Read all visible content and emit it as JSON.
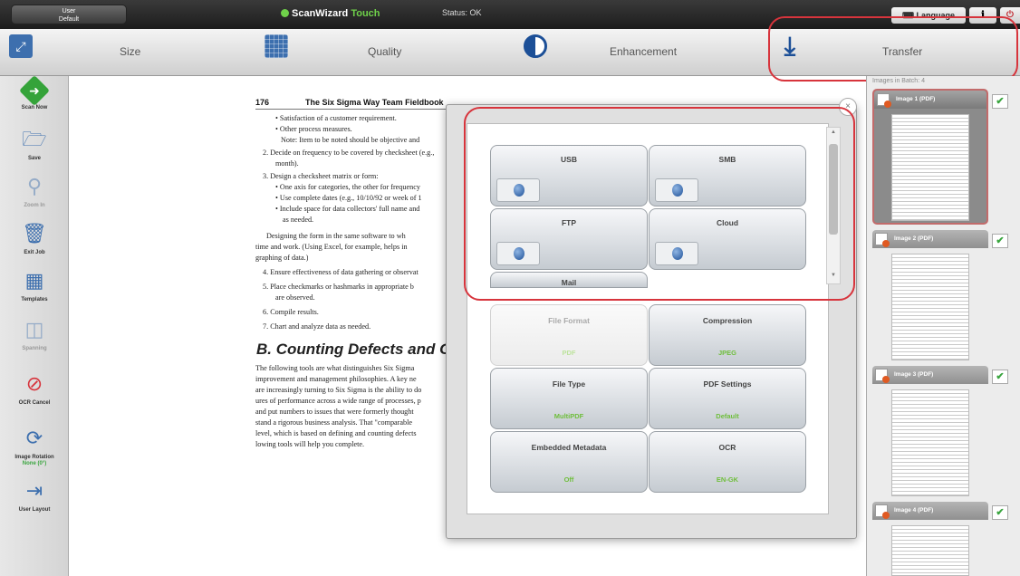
{
  "header": {
    "user_line1": "User",
    "user_line2": "Default",
    "app_name": "ScanWizard",
    "app_accent": "Touch",
    "status": "Status: OK",
    "language_label": "Language"
  },
  "toolbar": {
    "size_label": "Size",
    "quality_label": "Quality",
    "enhancement_label": "Enhancement",
    "transfer_label": "Transfer"
  },
  "sidebar": {
    "items": [
      {
        "label": "Scan Now",
        "icon": "scan-icon"
      },
      {
        "label": "Save",
        "icon": "folder-icon"
      },
      {
        "label": "Zoom In",
        "icon": "zoom-icon"
      },
      {
        "label": "Exit Job",
        "icon": "trash-icon"
      },
      {
        "label": "Templates",
        "icon": "templates-icon"
      },
      {
        "label": "Spanning",
        "icon": "spanning-icon"
      },
      {
        "label": "OCR Cancel",
        "icon": "ocr-cancel-icon"
      },
      {
        "label": "Image Rotation",
        "icon": "rotate-icon"
      },
      {
        "label": "User Layout",
        "icon": "exit-icon"
      }
    ],
    "rotation_value": "None (0°)"
  },
  "document": {
    "page_number": "176",
    "running_head": "The Six Sigma Way Team Fieldbook",
    "lines": [
      "• Satisfaction of a customer requirement.",
      "• Other process measures.",
      "Note: Item to be noted should be objective and",
      "2. Decide on frequency to be covered by checksheet (e.g.,",
      "month).",
      "3. Design a checksheet matrix or form:",
      "• One axis for categories, the other for frequency",
      "• Use complete dates (e.g., 10/10/92 or week of 1",
      "• Include space for data collectors' full name and",
      "as needed.",
      "Designing the form in the same software to wh",
      "time and work. (Using Excel, for example, helps in",
      "graphing of data.)",
      "4. Ensure effectiveness of data gathering or observat",
      "5. Place checkmarks or hashmarks in appropriate b",
      "are observed.",
      "6. Compile results.",
      "7. Chart and analyze data as needed.",
      "The following tools are what distinguishes Six Sigma",
      "improvement and management philosophies. A key ne",
      "are increasingly turning to Six Sigma is the ability to do",
      "ures of performance across a wide range of processes, p",
      "and put numbers to issues that were formerly thought",
      "stand a rigorous business analysis. That \"comparable",
      "level, which is based on defining and counting defects",
      "lowing tools will help you complete."
    ],
    "section_heading": "B. Counting Defects and Calcul"
  },
  "dialog": {
    "close_symbol": "×",
    "destinations": [
      {
        "label": "USB"
      },
      {
        "label": "SMB"
      },
      {
        "label": "FTP"
      },
      {
        "label": "Cloud"
      },
      {
        "label": "Mail"
      }
    ],
    "settings": [
      {
        "label": "File Format",
        "value": "PDF",
        "enabled": false
      },
      {
        "label": "Compression",
        "value": "JPEG",
        "enabled": true
      },
      {
        "label": "File Type",
        "value": "MultiPDF",
        "enabled": true
      },
      {
        "label": "PDF Settings",
        "value": "Default",
        "enabled": true
      },
      {
        "label": "Embedded Metadata",
        "value": "Off",
        "enabled": true
      },
      {
        "label": "OCR",
        "value": "EN-GK",
        "enabled": true
      }
    ]
  },
  "thumbnails": {
    "header": "Images in Batch: 4",
    "items": [
      {
        "name": "Image 1 (PDF)",
        "selected": true
      },
      {
        "name": "Image 2 (PDF)",
        "selected": false
      },
      {
        "name": "Image 3 (PDF)",
        "selected": false
      },
      {
        "name": "Image 4 (PDF)",
        "selected": false
      }
    ]
  },
  "colors": {
    "highlight": "#d7343c",
    "accent_green": "#6fbe3c",
    "brand_blue": "#1c4f97"
  }
}
